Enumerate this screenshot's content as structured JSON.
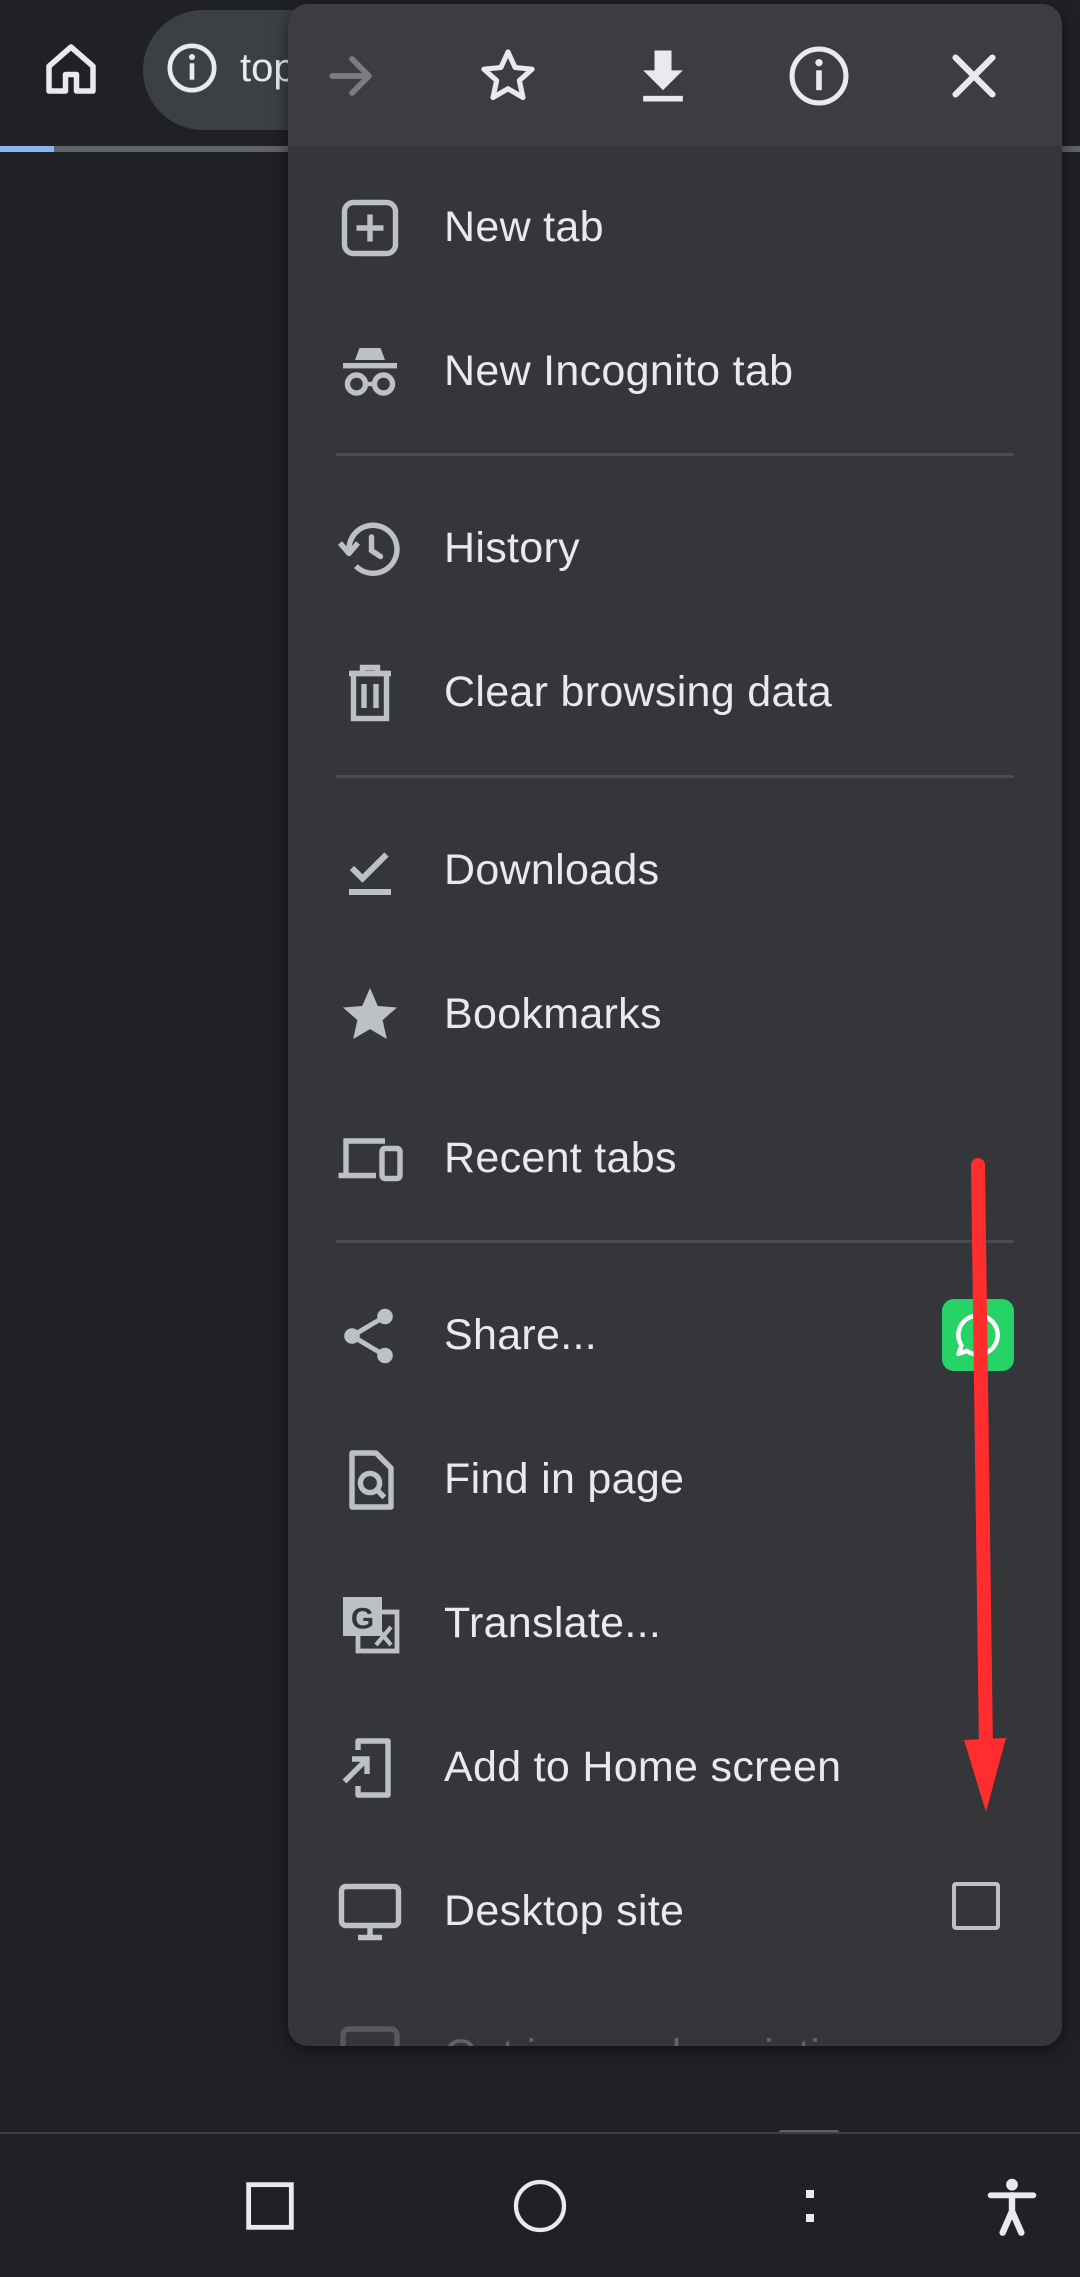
{
  "url_bar": {
    "text": "top",
    "progress": 0.05
  },
  "menu": {
    "toolbar": [
      "forward-icon",
      "bookmark-star-icon",
      "download-icon",
      "page-info-icon",
      "close-icon"
    ],
    "items": [
      {
        "label": "New tab",
        "icon": "new-tab-icon"
      },
      {
        "label": "New Incognito tab",
        "icon": "incognito-icon"
      },
      {
        "label": "History",
        "icon": "history-icon"
      },
      {
        "label": "Clear browsing data",
        "icon": "trash-icon"
      },
      {
        "label": "Downloads",
        "icon": "downloads-icon"
      },
      {
        "label": "Bookmarks",
        "icon": "star-icon"
      },
      {
        "label": "Recent tabs",
        "icon": "devices-icon"
      },
      {
        "label": "Share...",
        "icon": "share-icon",
        "extra": "whatsapp-icon"
      },
      {
        "label": "Find in page",
        "icon": "find-in-page-icon"
      },
      {
        "label": "Translate...",
        "icon": "translate-icon"
      },
      {
        "label": "Add to Home screen",
        "icon": "add-to-home-icon"
      },
      {
        "label": "Desktop site",
        "icon": "desktop-icon",
        "checkbox": false
      },
      {
        "label": "Get image descriptions",
        "icon": "image-description-icon"
      }
    ]
  },
  "annotation": {
    "color": "#ff2d2d",
    "direction": "down"
  },
  "navbar": [
    "recents-square-icon",
    "home-circle-icon",
    "menu-dots-icon",
    "accessibility-icon"
  ]
}
